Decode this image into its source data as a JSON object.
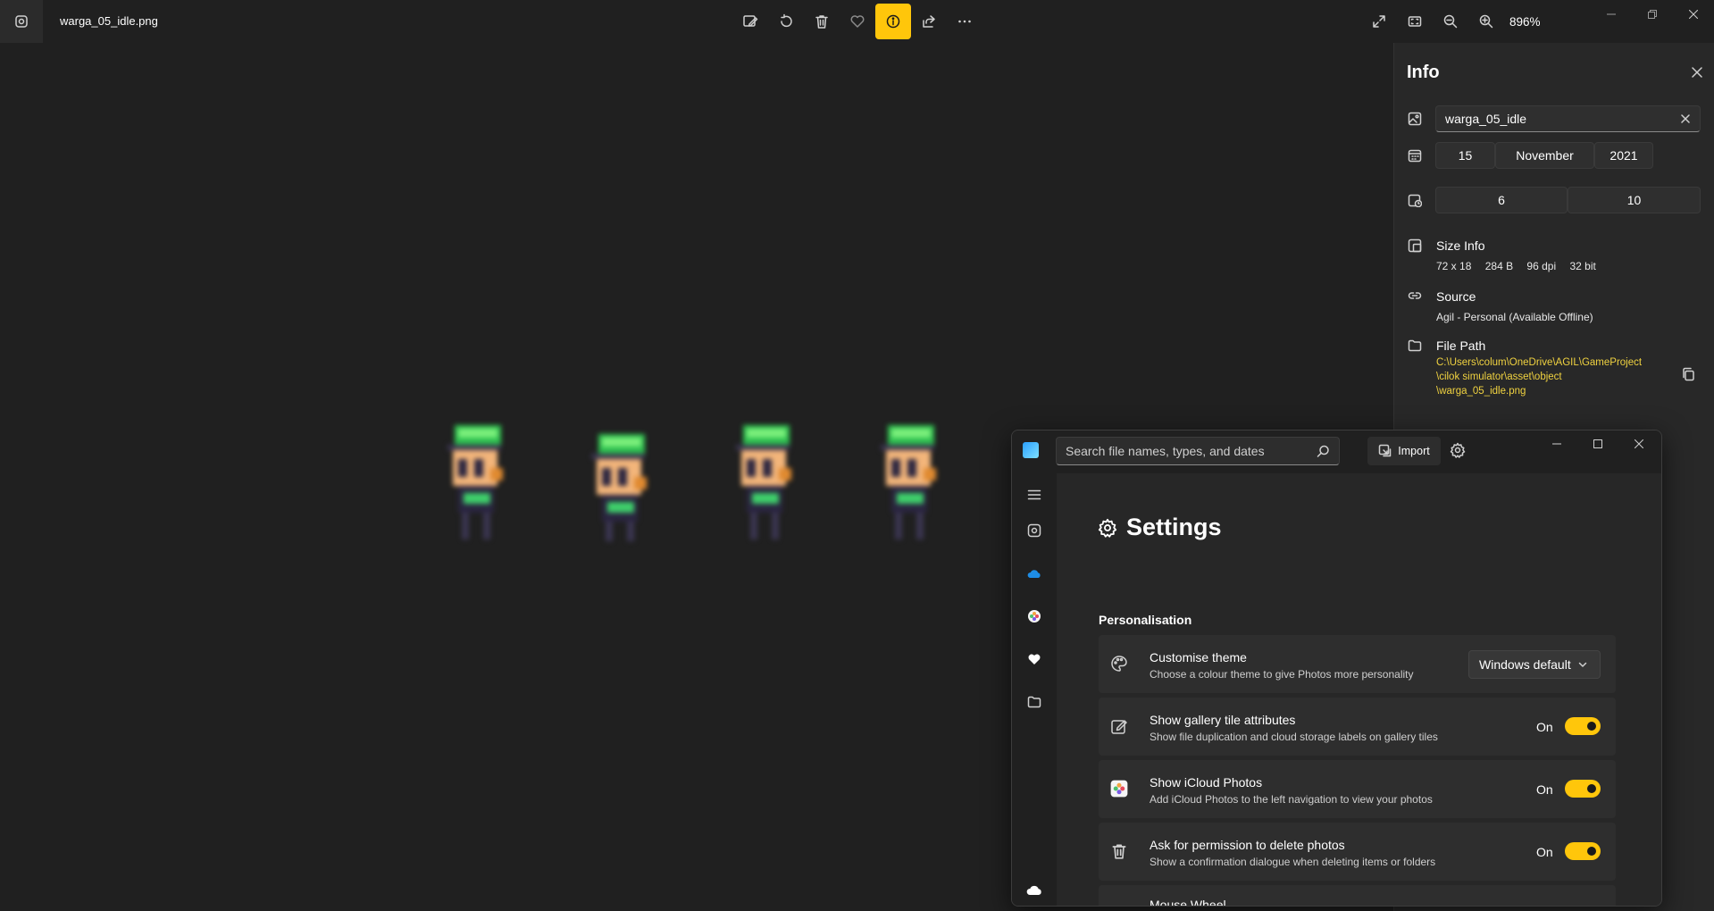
{
  "app": {
    "file_name": "warga_05_idle.png",
    "zoom": "896%"
  },
  "toolbar": {
    "edit": "edit-icon",
    "rotate": "rotate-icon",
    "delete": "trash-icon",
    "favorite": "heart-icon",
    "info": "info-icon",
    "share": "share-icon",
    "more": "more-icon"
  },
  "colors": {
    "accent": "#ffc60b",
    "background": "#202020",
    "panel": "#282828",
    "path_text": "#f0d240"
  },
  "info_panel": {
    "title": "Info",
    "name": "warga_05_idle",
    "date": {
      "day": "15",
      "month": "November",
      "year": "2021"
    },
    "time": {
      "hour": "6",
      "minute": "10"
    },
    "size_info_label": "Size Info",
    "size_info": {
      "dimensions": "72 x 18",
      "size": "284 B",
      "dpi": "96 dpi",
      "bits": "32 bit"
    },
    "source_label": "Source",
    "source": "Agil - Personal (Available Offline)",
    "file_path_label": "File Path",
    "file_path_lines": [
      "C:\\Users\\colum\\OneDrive\\AGIL\\GameProject",
      "\\cilok simulator\\asset\\object",
      "\\warga_05_idle.png"
    ]
  },
  "settings_window": {
    "search_placeholder": "Search file names, types, and dates",
    "import_label": "Import",
    "heading": "Settings",
    "section": "Personalisation",
    "storage_fraction": 0.4,
    "cards": [
      {
        "title": "Customise theme",
        "desc": "Choose a colour theme to give Photos more personality",
        "value": "Windows default"
      },
      {
        "title": "Show gallery tile attributes",
        "desc": "Show file duplication and cloud storage labels on gallery tiles",
        "state": "On"
      },
      {
        "title": "Show iCloud Photos",
        "desc": "Add iCloud Photos to the left navigation to view your photos",
        "state": "On"
      },
      {
        "title": "Ask for permission to delete photos",
        "desc": "Show a confirmation dialogue when deleting items or folders",
        "state": "On"
      },
      {
        "title": "Mouse Wheel"
      }
    ]
  }
}
